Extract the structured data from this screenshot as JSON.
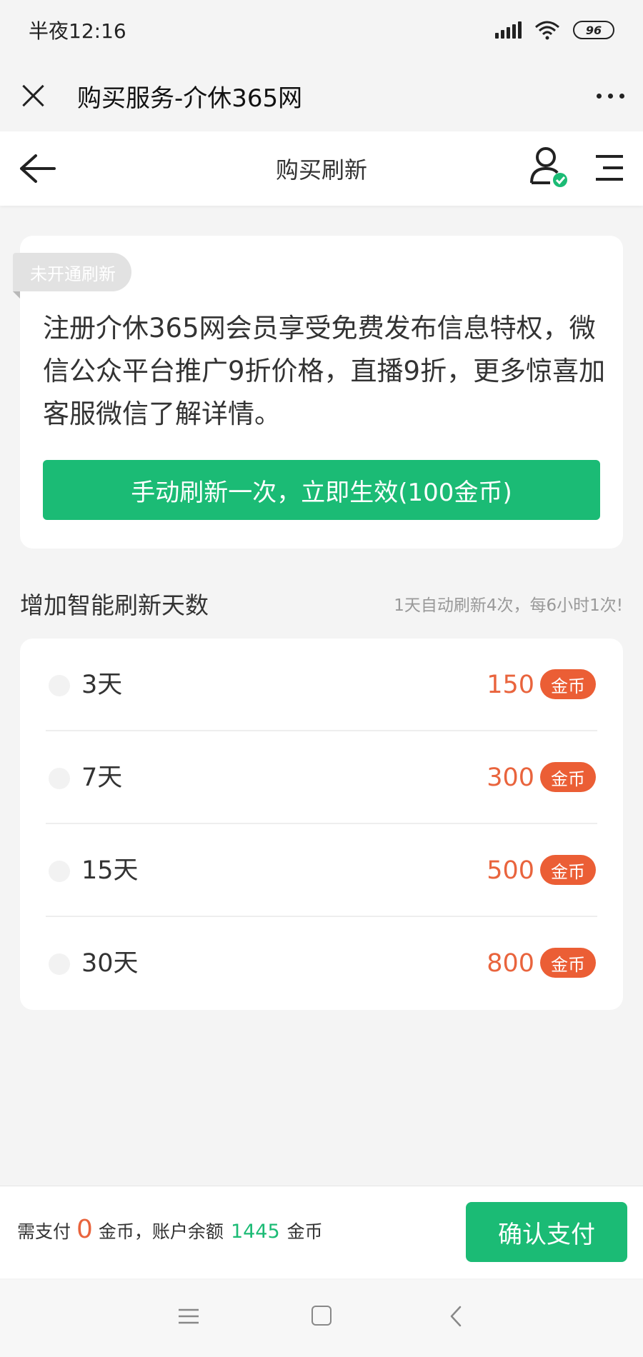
{
  "status_bar": {
    "time": "半夜12:16",
    "battery": "96"
  },
  "wechat_bar": {
    "title": "购买服务-介休365网"
  },
  "nav": {
    "title": "购买刷新"
  },
  "promo_card": {
    "badge": "未开通刷新",
    "text": "注册介休365网会员享受免费发布信息特权，微信公众平台推广9折价格，直播9折，更多惊喜加客服微信了解详情。",
    "button_label": "手动刷新一次，立即生效(100金币)"
  },
  "smart_refresh": {
    "title": "增加智能刷新天数",
    "note": "1天自动刷新4次，每6小时1次!",
    "options": [
      {
        "label": "3天",
        "price": "150",
        "unit": "金币"
      },
      {
        "label": "7天",
        "price": "300",
        "unit": "金币"
      },
      {
        "label": "15天",
        "price": "500",
        "unit": "金币"
      },
      {
        "label": "30天",
        "price": "800",
        "unit": "金币"
      }
    ]
  },
  "payment": {
    "need_pay_label": "需支付",
    "amount": "0",
    "unit_comma": "金币，账户余额",
    "balance": "1445",
    "unit": "金币",
    "confirm_label": "确认支付"
  },
  "colors": {
    "accent_green": "#1bbb75",
    "price_orange": "#e9643d"
  }
}
